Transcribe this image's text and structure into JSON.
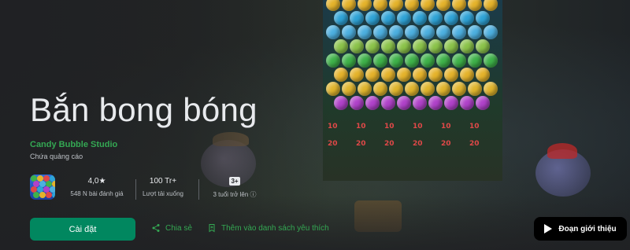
{
  "app": {
    "title": "Bắn bong bóng",
    "developer": "Candy Bubble Studio",
    "ads_note": "Chứa quảng cáo"
  },
  "stats": {
    "rating_value": "4,0★",
    "reviews": "548 N bài đánh giá",
    "downloads_value": "100 Tr+",
    "downloads_label": "Lượt tải xuống",
    "age_badge": "3+",
    "age_label": "3 tuổi trở lên ⓘ"
  },
  "actions": {
    "install": "Cài đặt",
    "share": "Chia sẻ",
    "wishlist": "Thêm vào danh sách yêu thích",
    "trailer": "Đoạn giới thiệu"
  },
  "game_scores": [
    "10",
    "10",
    "10",
    "10",
    "10",
    "10",
    "20",
    "20",
    "20",
    "20",
    "20",
    "20"
  ],
  "colors": {
    "accent_green": "#34a853",
    "install_green": "#01875f",
    "background": "#202124"
  },
  "icons": [
    "share-icon",
    "bookmark-add-icon",
    "play-icon",
    "info-icon"
  ]
}
